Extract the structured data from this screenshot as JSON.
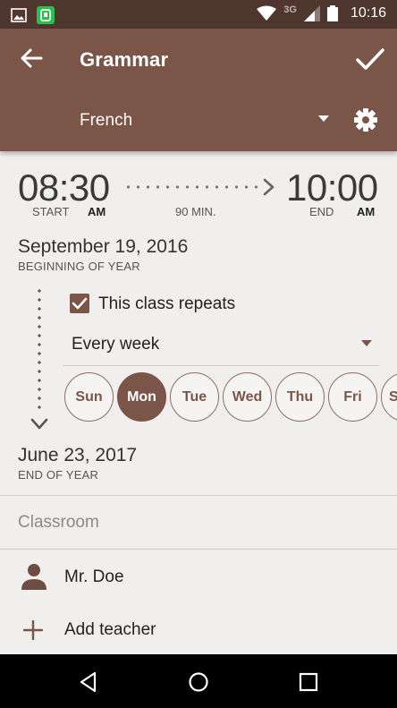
{
  "status_bar": {
    "time": "10:16",
    "network": "3G",
    "icons": [
      "image-icon",
      "app-notification-icon",
      "wifi-icon",
      "signal-icon",
      "battery-icon"
    ]
  },
  "app_bar": {
    "title": "Grammar",
    "subject": "French",
    "icons": [
      "back-arrow-icon",
      "check-icon",
      "dropdown-arrow-icon",
      "gear-icon"
    ]
  },
  "time_range": {
    "start_time": "08:30",
    "start_label": "START",
    "start_ampm": "AM",
    "duration": "90 MIN.",
    "end_time": "10:00",
    "end_label": "END",
    "end_ampm": "AM"
  },
  "start_date": {
    "date": "September 19, 2016",
    "caption": "BEGINNING OF YEAR"
  },
  "repeat": {
    "checked": true,
    "label": "This class repeats",
    "frequency": "Every week",
    "days": [
      "Sun",
      "Mon",
      "Tue",
      "Wed",
      "Thu",
      "Fri",
      "Sat"
    ],
    "selected_day": "Mon"
  },
  "end_date": {
    "date": "June 23, 2017",
    "caption": "END OF YEAR"
  },
  "classroom": {
    "placeholder": "Classroom"
  },
  "teachers": {
    "name": "Mr. Doe",
    "add_label": "Add teacher"
  },
  "colors": {
    "status_bar": "#4f362e",
    "app_bar": "#7b5548",
    "accent": "#7b5548",
    "background": "#f0efee"
  }
}
